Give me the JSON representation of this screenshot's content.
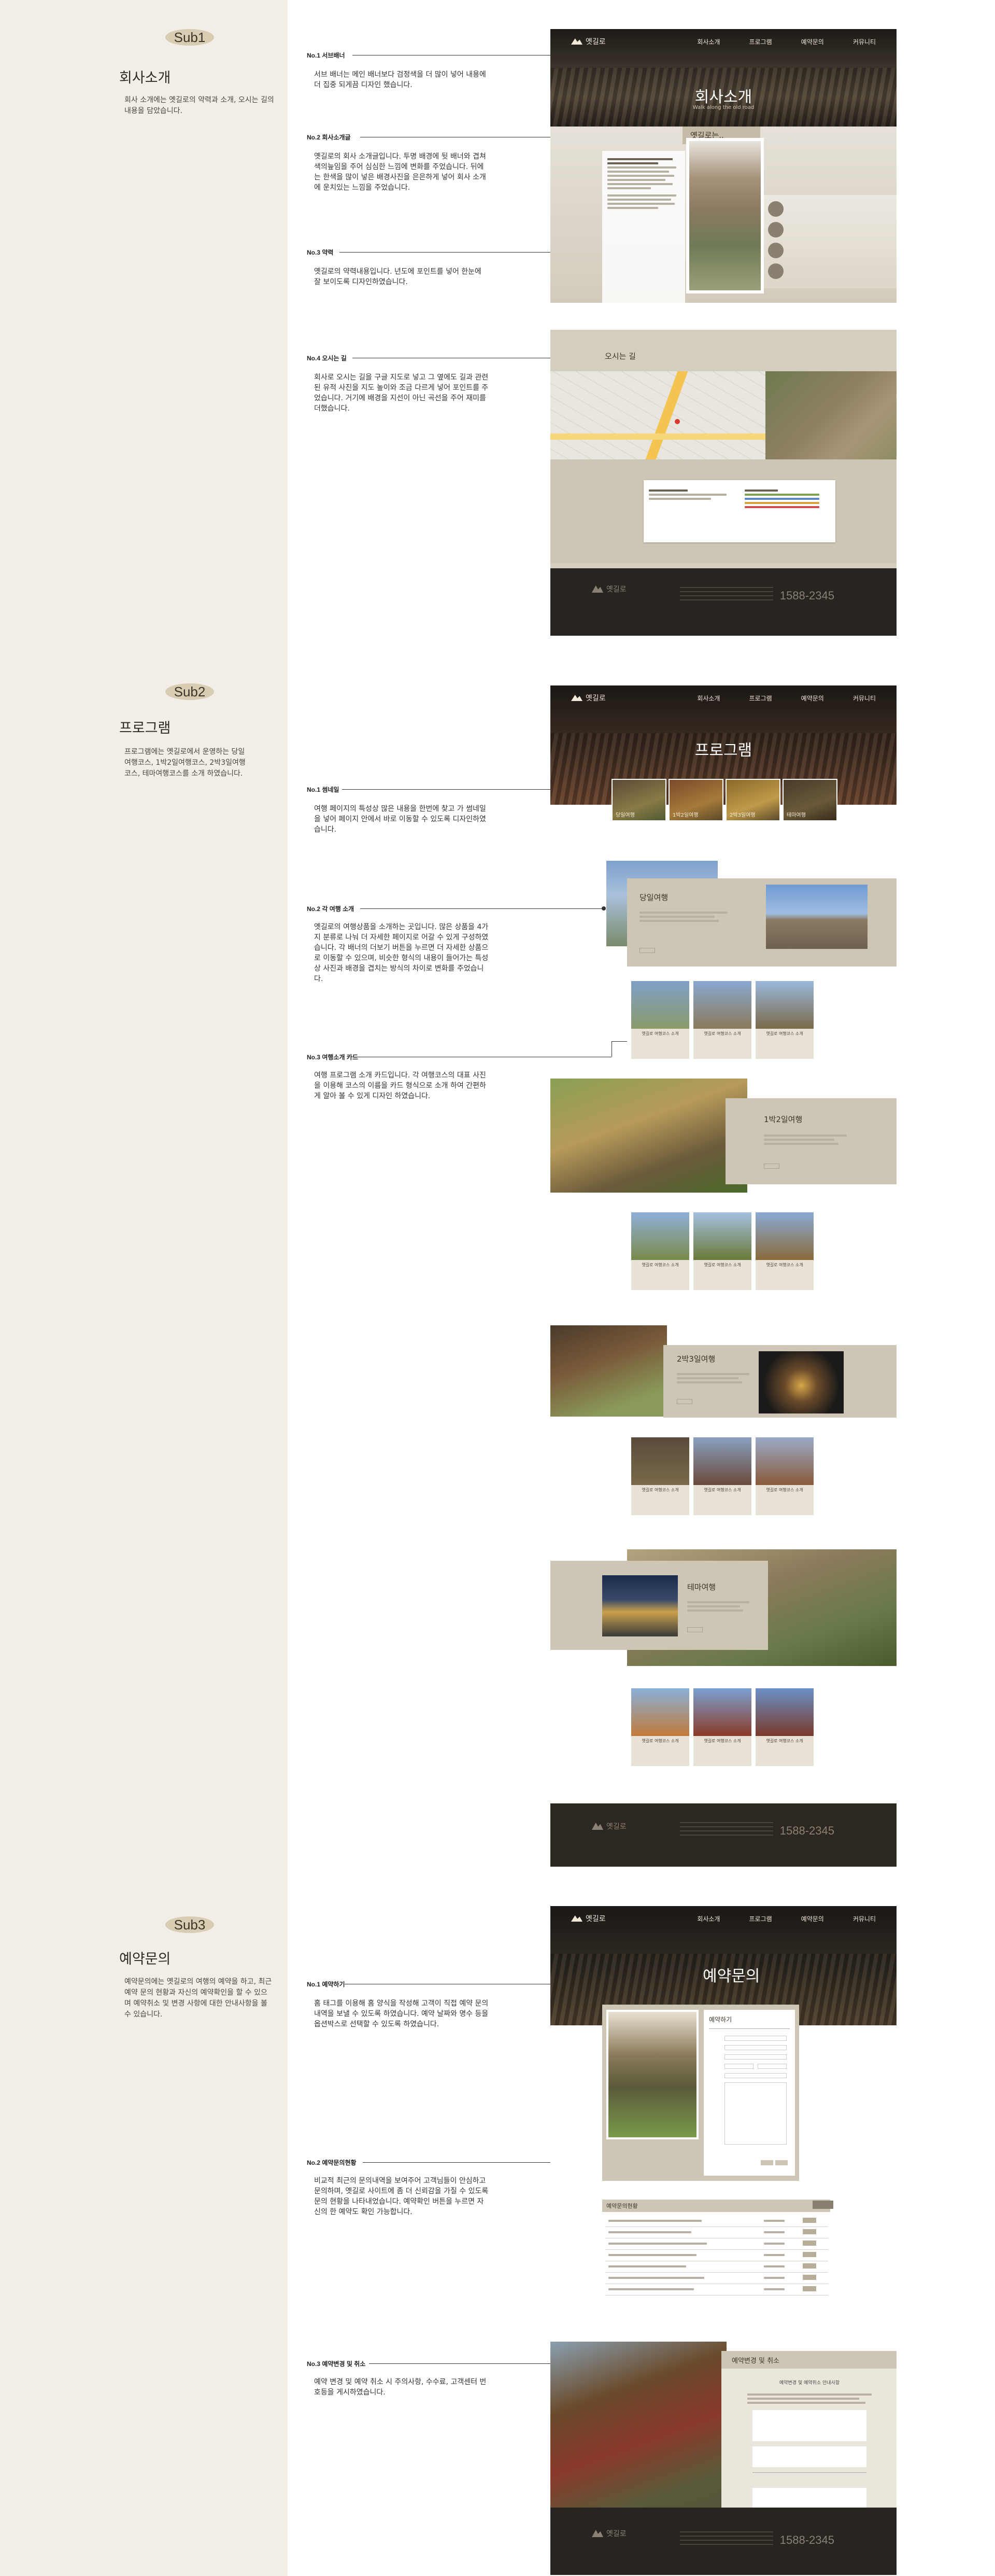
{
  "colors": {
    "sidebar": "#f2ede6",
    "badge": "#d8ccb3",
    "dark": "#2c2820",
    "beige": "#cdc6b5",
    "text": "#2e2a25"
  },
  "sub1": {
    "badge": "Sub1",
    "title": "회사소개",
    "desc": "회사 소개에는 옛길로의 약력과 소개, 오시는 길의 내용을 담았습니다.",
    "annotations": [
      {
        "title": "No.1 서브배너",
        "body": "서브 배너는 메인 배너보다 검정색을 더 많이 넣어 내용에 더 집중 되게끔 디자인 했습니다."
      },
      {
        "title": "No.2 회사소개글",
        "body": "옛길로의 회사 소개글입니다. 투명 배경에 뒷 배너와 겹쳐 색의늪임을 주어 심심한 느낌에 변화를 주었습니다. 뒤에는 한색을 많이 넣은 배경사진을 은은하게 넣어 회사 소개에 운치있는 느낌을 주었습니다."
      },
      {
        "title": "No.3 약력",
        "body": "옛길로의 약력내용입니다. 년도에 포인트를 넣어 한눈에 잘 보이도록 디자인하였습니다."
      },
      {
        "title": "No.4 오시는 길",
        "body": "회사로 오시는 길을 구글 지도로 넣고 그 옆에도 길과 관련된 유적 사진을 지도 높이와 조금 다르게 넣어 포인트를 주었습니다. 거기에 배경을 지선이 아닌 곡선을 주어 재미를 더했습니다."
      }
    ],
    "mock": {
      "nav_brand": "옛길로",
      "nav_items": [
        "회사소개",
        "프로그램",
        "예약문의",
        "커뮤니티"
      ],
      "hero_title": "회사소개",
      "hero_sub": "Walk along the old road",
      "intro_tag": "옛길로는..",
      "map_tag": "오시는 길",
      "tel": "1588-2345"
    }
  },
  "sub2": {
    "badge": "Sub2",
    "title": "프로그램",
    "desc": "프로그램에는 옛길로에서 운영하는 당일여행코스, 1박2일여행코스, 2박3일여행코스, 테마여행코스를 소개 하였습니다.",
    "annotations": [
      {
        "title": "No.1 썸네일",
        "body": "여행 페이지의 특성상 많은 내용을 한번에 찾고 가 썸네일을 넣어 페이지 안에서 바로 이동할 수 있도록 디자인하였습니다."
      },
      {
        "title": "No.2 각 여행 소개",
        "body": "옛길로의 여행상품을 소개하는 곳입니다. 많은 상품을 4가지 분류로 나눠 더 자세한 페이지로 어갈 수 있게 구성하였습니다. 각 배너의 더보기 버튼을 누르면 더 자세한 상품으로 이동할 수 있으며, 비슷한 형식의 내용이 들어가는 특성상 사진과 배경을 겹치는 방식의 차이로 변화를 주었습니다."
      },
      {
        "title": "No.3 여행소개 카드",
        "body": "여행 프로그램 소개 카드입니다. 각 여행코스의 대표 사진을 이용해 코스의 이름을 카드 형식으로 소개 하여 간편하게 알아 볼 수 있게 디자인 하였습니다."
      }
    ],
    "mock": {
      "hero_title": "프로그램",
      "thumbs": [
        "당일여행",
        "1박2일여행",
        "2박3일여행",
        "테마여행"
      ],
      "course_titles": [
        "당일여행",
        "1박2일여행",
        "2박3일여행",
        "테마여행"
      ],
      "card_text": "옛길로 여행코스 소개"
    }
  },
  "sub3": {
    "badge": "Sub3",
    "title": "예약문의",
    "desc": "예약문의에는 옛길로의 여행의 예약을 하고, 최근 예약 문의 현황과 자신의 예약확인을 할 수 있으며 예약취소 및 변경 사항에 대한 안내사항을 볼 수 있습니다.",
    "annotations": [
      {
        "title": "No.1 예약하기",
        "body": "홈 태그를 이용해 홈 양식을 작성해 고객이 직접 예약 문의내역을 보낼 수 있도록 하였습니다. 예약 날짜와 명수 등을 옵션박스로 선택할 수 있도록 하였습니다."
      },
      {
        "title": "No.2 예약문의현황",
        "body": "비교적 최근의 문의내역을 보여주어 고객님들이 안심하고 문의하며, 옛길로 사이트에 좀 더 신뢰감을 가질 수 있도록 문의 현황을 나타내었습니다. 예약확인 버튼을 누르면 자신의 한 예약도 확인 가능합니다."
      },
      {
        "title": "No.3 예약변경 및 취소",
        "body": "예약 변경 및 예약 취소 시 주의사항, 수수료, 고객센터 번호등을 게시하였습니다."
      }
    ],
    "mock": {
      "hero_title": "예약문의",
      "form_title": "예약하기",
      "status_title": "예약문의현황",
      "change_title": "예약변경 및 취소",
      "change_heading": "예약변경 및 예약취소 안내사항",
      "tel": "1588-2345"
    }
  }
}
